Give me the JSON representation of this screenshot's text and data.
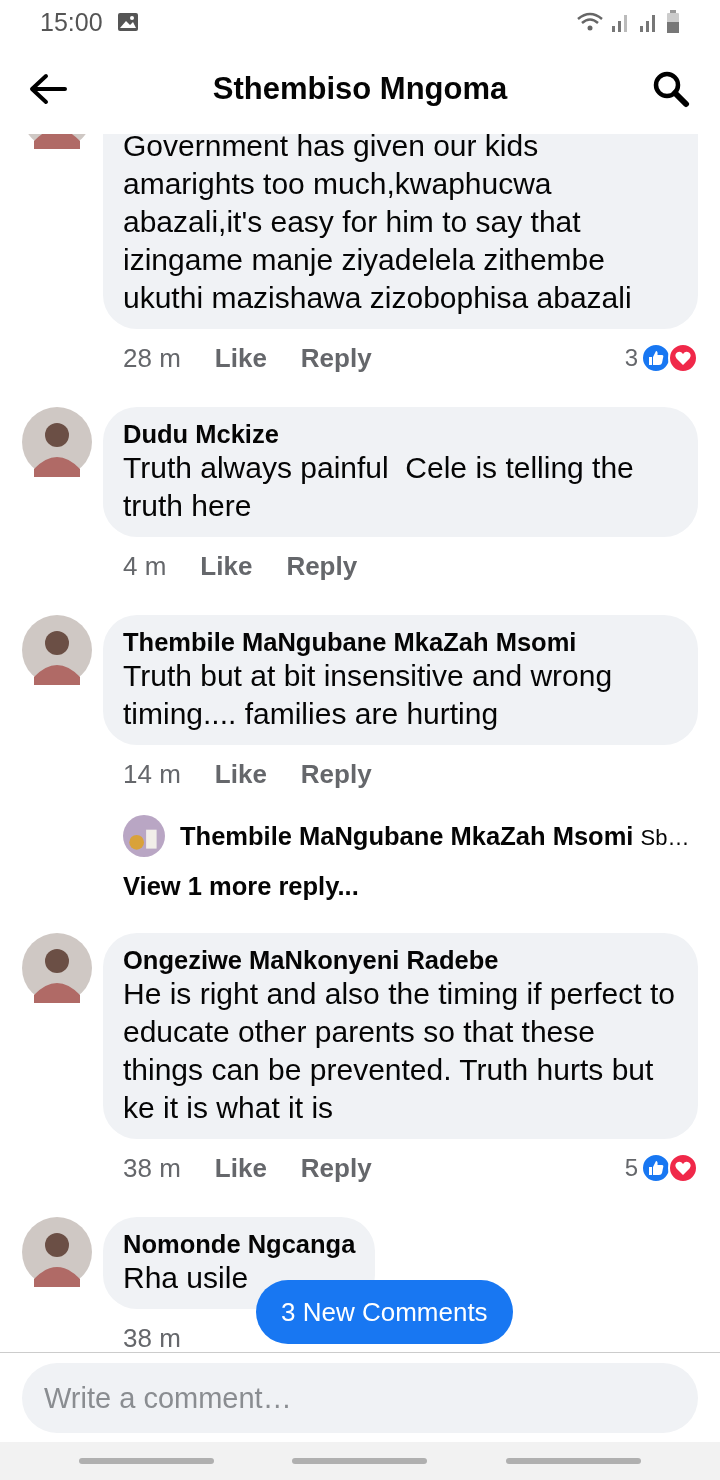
{
  "status_bar": {
    "time": "15:00"
  },
  "header": {
    "title": "Sthembiso Mngoma"
  },
  "comments": [
    {
      "kind": "comment",
      "text": "Government has given our kids amarights too much,kwaphucwa abazali,it's easy for him to say that izingame manje ziyadelela zithembe ukuthi mazishawa zizobophisa abazali",
      "time": "28 m",
      "like": "Like",
      "reply": "Reply",
      "reactions": "3"
    },
    {
      "kind": "comment",
      "name": "Dudu Mckize",
      "text": "Truth always painful  Cele is telling the truth here",
      "time": "4 m",
      "like": "Like",
      "reply": "Reply"
    },
    {
      "kind": "comment",
      "name": "Thembile MaNgubane MkaZah Msomi",
      "text": "Truth but at bit insensitive and wrong timing.... families are hurting",
      "time": "14 m",
      "like": "Like",
      "reply": "Reply"
    },
    {
      "kind": "replies",
      "name": "Thembile MaNgubane MkaZah Msomi",
      "snippet": "Sb…",
      "more": "View 1 more reply..."
    },
    {
      "kind": "comment",
      "name": "Ongeziwe MaNkonyeni Radebe",
      "text": "He is right and also the timing if perfect to educate other parents so that these things can be prevented. Truth hurts but ke it is what it is",
      "time": "38 m",
      "like": "Like",
      "reply": "Reply",
      "reactions": "5"
    },
    {
      "kind": "comment",
      "name": "Nomonde Ngcanga",
      "text": "Rha usile",
      "time": "38 m"
    }
  ],
  "new_comments": "3 New Comments",
  "composer": {
    "placeholder": "Write a comment…"
  }
}
